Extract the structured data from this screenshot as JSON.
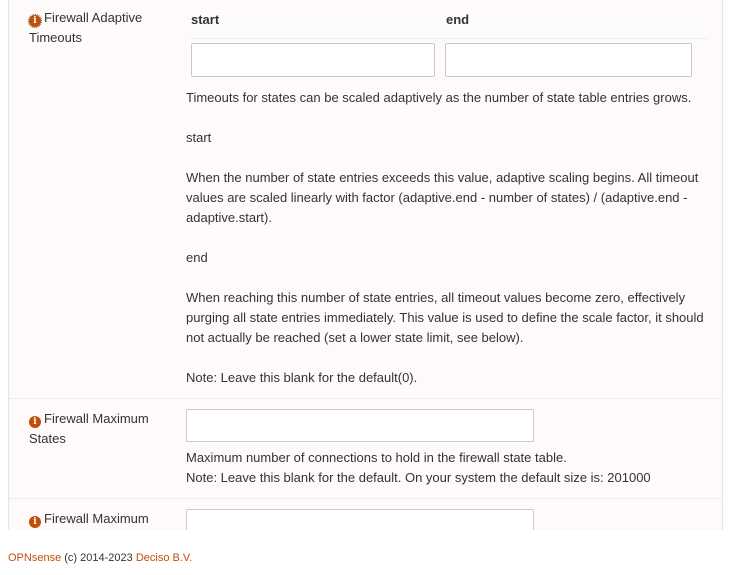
{
  "adaptive": {
    "label": "Firewall Adaptive Timeouts",
    "col_start": "start",
    "col_end": "end",
    "start_value": "",
    "end_value": "",
    "help_intro": "Timeouts for states can be scaled adaptively as the number of state table entries grows.",
    "help_start_title": "start",
    "help_start_text": "When the number of state entries exceeds this value, adaptive scaling begins. All timeout values are scaled linearly with factor (adaptive.end - number of states) / (adaptive.end - adaptive.start).",
    "help_end_title": "end",
    "help_end_text": "When reaching this number of state entries, all timeout values become zero, effectively purging all state entries immediately. This value is used to define the scale factor, it should not actually be reached (set a lower state limit, see below).",
    "help_note": "Note: Leave this blank for the default(0)."
  },
  "max_states": {
    "label": "Firewall Maximum States",
    "value": "",
    "help_line1": "Maximum number of connections to hold in the firewall state table.",
    "help_line2": "Note: Leave this blank for the default. On your system the default size is: 201000"
  },
  "max_next": {
    "label": "Firewall Maximum",
    "value": ""
  },
  "footer": {
    "brand": "OPNsense",
    "copyright": "(c) 2014-2023",
    "company": "Deciso B.V."
  },
  "colors": {
    "accent": "#c44d0a",
    "panel_bg": "#fffafa"
  },
  "icons": {
    "info": "info-circle-icon"
  }
}
